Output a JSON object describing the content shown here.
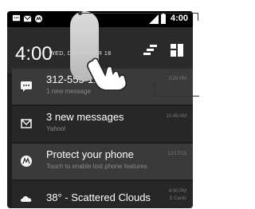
{
  "status_bar": {
    "time": "4:00",
    "icons": [
      "message-icon",
      "email-icon",
      "motorola-icon",
      "signal-icon",
      "battery-icon"
    ]
  },
  "shade": {
    "time": "4:00",
    "date": "WED, DECEMBER 18",
    "buttons": [
      "settings-toggle-icon",
      "quick-settings-icon"
    ]
  },
  "notifications": [
    {
      "icon": "message-icon",
      "title": "312-555-1234",
      "subtitle": "1 new message",
      "time": "3:29 PM"
    },
    {
      "icon": "email-icon",
      "title": "3 new messages",
      "subtitle": "Yahoo!",
      "time": "10:49 AM"
    },
    {
      "icon": "motorola-icon",
      "title": "Protect your phone",
      "subtitle": "Touch to enable lost phone features",
      "time": "12/17/13"
    },
    {
      "icon": "cloud-icon",
      "title": "38° - Scattered Clouds",
      "subtitle": "",
      "time": "4:00 PM",
      "time2": "5 Cards"
    }
  ],
  "colors": {
    "accent": "#3b6fa8",
    "panel": "#2a2a2a",
    "notification_bg": "#3a3a3a"
  }
}
